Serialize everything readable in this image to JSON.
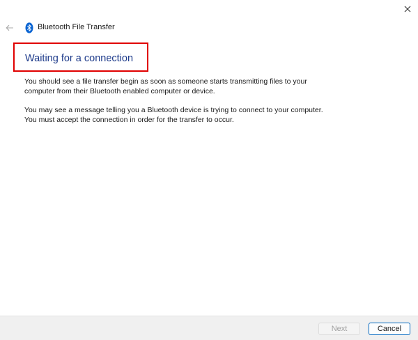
{
  "window": {
    "title": "Bluetooth File Transfer",
    "accent_color": "#0067c0",
    "highlight_color": "#e00000"
  },
  "icons": {
    "back": "back-arrow-icon",
    "app": "bluetooth-icon",
    "close": "close-icon"
  },
  "content": {
    "heading": "Waiting for a connection",
    "paragraph1": "You should see a file transfer begin as soon as someone starts transmitting files to your computer from their Bluetooth enabled computer or device.",
    "paragraph2": "You may see a message telling you a Bluetooth device is trying to connect to your computer. You must accept the connection in order for the transfer to occur."
  },
  "footer": {
    "next_label": "Next",
    "cancel_label": "Cancel"
  }
}
